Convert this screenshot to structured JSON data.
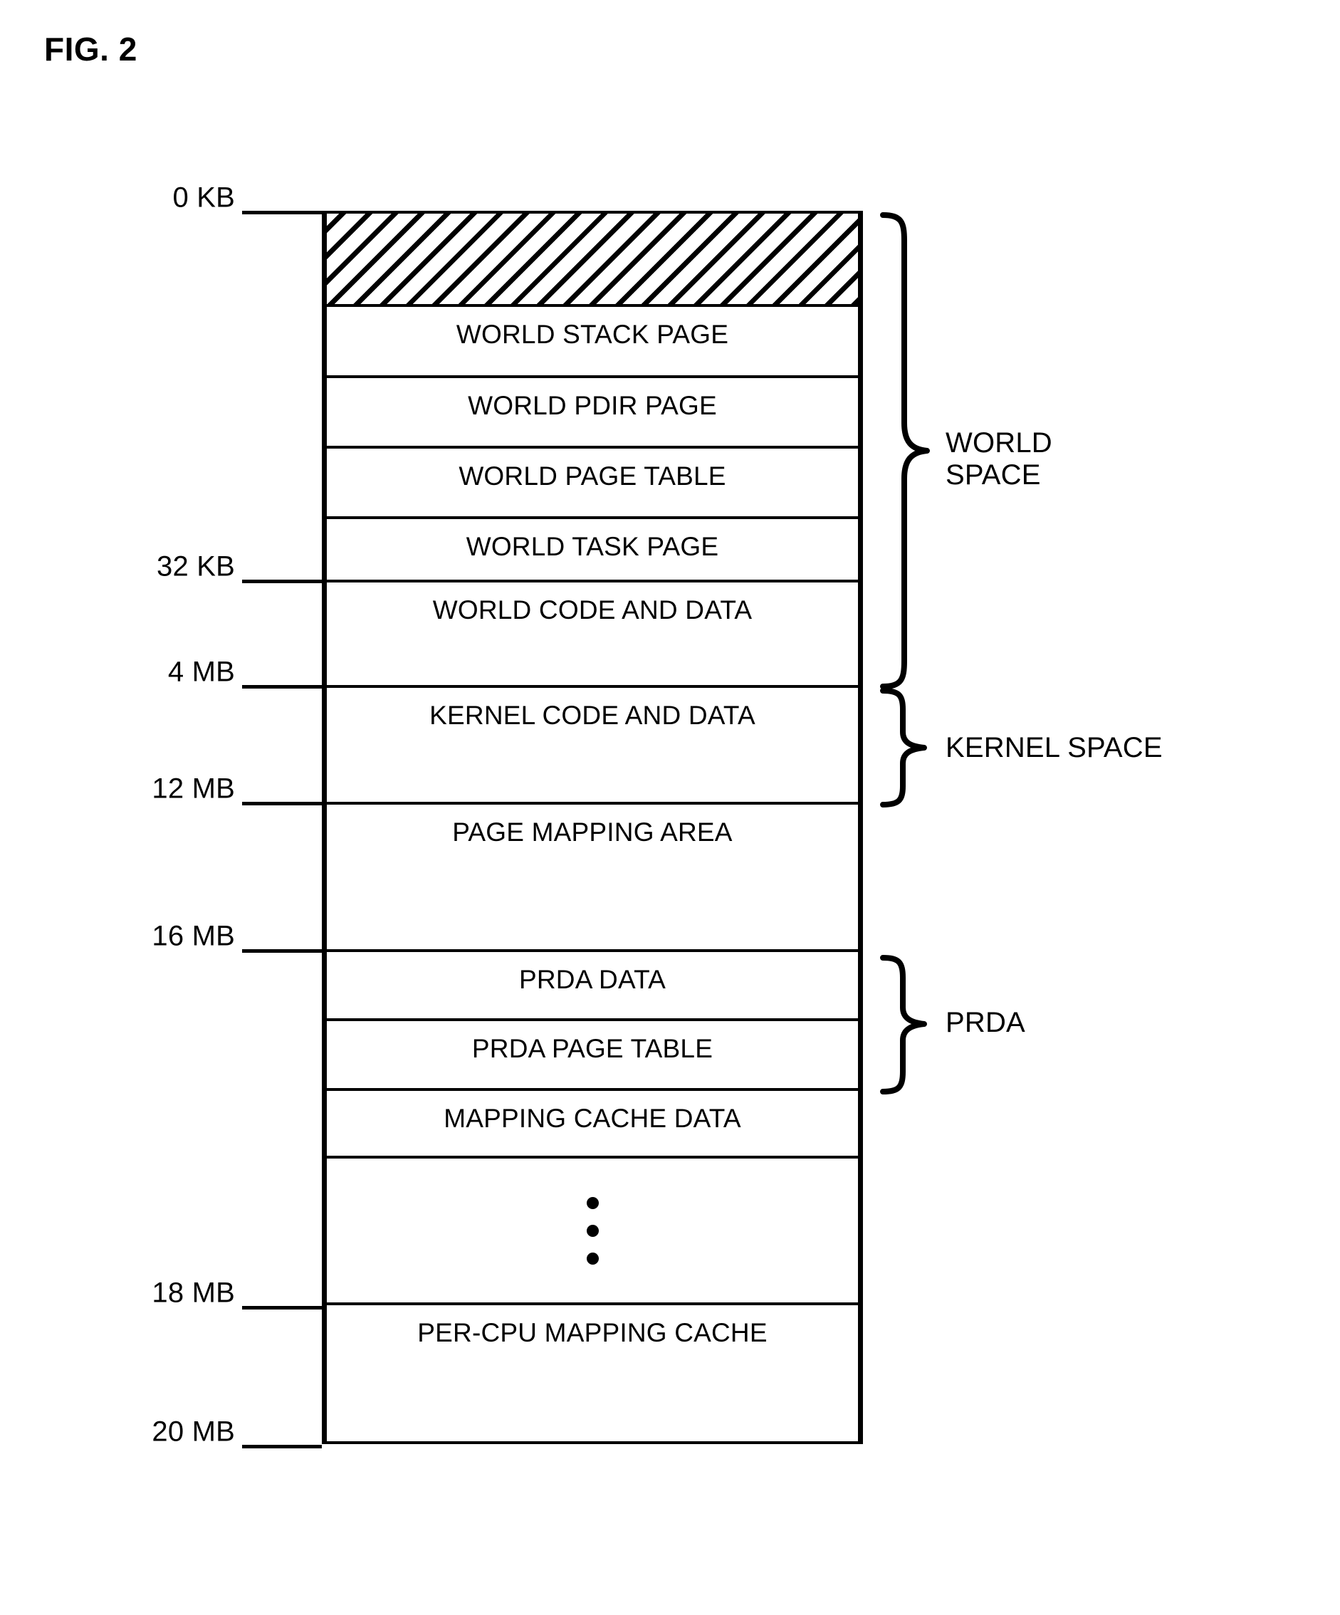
{
  "figure": {
    "title": "FIG. 2",
    "type": "memory-layout-diagram"
  },
  "chart_data": {
    "type": "table",
    "title": "FIG. 2",
    "description": "Virtual memory address space layout diagram",
    "ylabel": "Memory address",
    "rows": [
      {
        "label": "",
        "hatched": true
      },
      {
        "label": "WORLD STACK PAGE",
        "hatched": false
      },
      {
        "label": "WORLD PDIR PAGE",
        "hatched": false
      },
      {
        "label": "WORLD PAGE TABLE",
        "hatched": false
      },
      {
        "label": "WORLD TASK PAGE",
        "hatched": false
      },
      {
        "label": "WORLD CODE AND DATA",
        "hatched": false
      },
      {
        "label": "KERNEL CODE AND DATA",
        "hatched": false
      },
      {
        "label": "PAGE MAPPING AREA",
        "hatched": false
      },
      {
        "label": "PRDA DATA",
        "hatched": false
      },
      {
        "label": "PRDA PAGE TABLE",
        "hatched": false
      },
      {
        "label": "MAPPING CACHE DATA",
        "hatched": false
      },
      {
        "label": "",
        "hatched": false
      },
      {
        "label": "PER-CPU MAPPING CACHE",
        "hatched": false
      }
    ],
    "address_ticks": [
      "0 KB",
      "32 KB",
      "4 MB",
      "12 MB",
      "16 MB",
      "18 MB",
      "20 MB"
    ],
    "groups": [
      "WORLD SPACE",
      "KERNEL SPACE",
      "PRDA"
    ]
  },
  "rows": {
    "hatched_top": "",
    "world_stack_page": "WORLD STACK PAGE",
    "world_pdir_page": "WORLD PDIR PAGE",
    "world_page_table": "WORLD PAGE TABLE",
    "world_task_page": "WORLD TASK PAGE",
    "world_code_and_data": "WORLD CODE AND DATA",
    "kernel_code_and_data": "KERNEL CODE AND DATA",
    "page_mapping_area": "PAGE MAPPING AREA",
    "prda_data": "PRDA DATA",
    "prda_page_table": "PRDA PAGE TABLE",
    "mapping_cache_data": "MAPPING CACHE DATA",
    "ellipsis": "",
    "per_cpu_mapping_cache": "PER-CPU MAPPING CACHE"
  },
  "ticks": {
    "t0": "0 KB",
    "t32kb": "32 KB",
    "t4mb": "4 MB",
    "t12mb": "12 MB",
    "t16mb": "16 MB",
    "t18mb": "18 MB",
    "t20mb": "20 MB"
  },
  "braces": {
    "world_space": "WORLD\nSPACE",
    "kernel_space": "KERNEL SPACE",
    "prda": "PRDA"
  }
}
